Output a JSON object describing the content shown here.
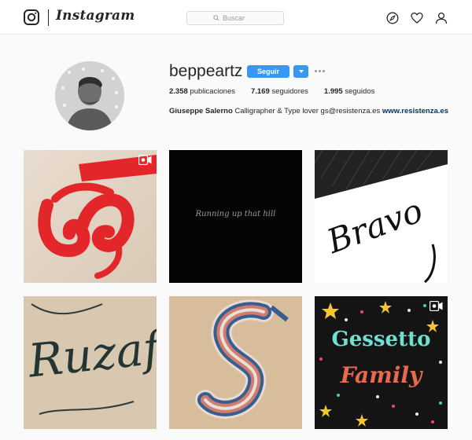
{
  "header": {
    "wordmark": "Instagram",
    "search_placeholder": "Buscar"
  },
  "icons": {
    "logo": "instagram-camera-icon",
    "search": "search-icon",
    "explore": "compass-icon",
    "activity": "heart-icon",
    "profile": "person-icon",
    "video": "video-camera-icon"
  },
  "profile": {
    "username": "beppeartz",
    "follow_label": "Seguir",
    "stats": {
      "posts_count": "2.358",
      "posts_label": "publicaciones",
      "followers_count": "7.169",
      "followers_label": "seguidores",
      "following_count": "1.995",
      "following_label": "seguidos"
    },
    "bio": {
      "name": "Giuseppe Salerno",
      "text": "Calligrapher & Type lover gs@resistenza.es",
      "link": "www.resistenza.es"
    }
  },
  "posts": [
    {
      "art": "Red calligraphic glyph on paper",
      "video": true
    },
    {
      "caption": "Running up that hill",
      "video": false
    },
    {
      "caption": "Bravo",
      "video": false
    },
    {
      "caption": "Ruzaf",
      "video": false
    },
    {
      "caption": "S",
      "video": false
    },
    {
      "caption_top": "Gessetto",
      "caption_bottom": "Family",
      "video": true
    }
  ],
  "colors": {
    "accent": "#3897f0",
    "link": "#003569",
    "background": "#fafafa"
  }
}
